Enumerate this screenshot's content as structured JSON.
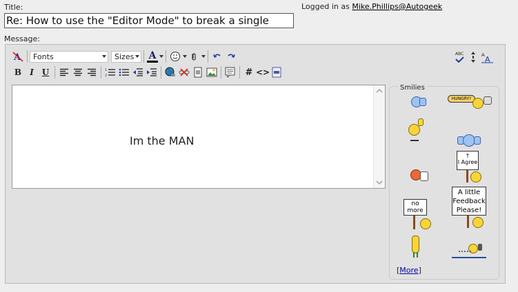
{
  "header": {
    "title_label": "Title:",
    "logged_in_prefix": "Logged in as ",
    "username": "Mike.Phillips@Autogeek"
  },
  "title_input": {
    "value": "Re: How to use the \"Editor Mode\" to break a single"
  },
  "message_label": "Message:",
  "toolbar": {
    "font_select": "Fonts",
    "size_select": "Sizes",
    "font_color_glyph": "A",
    "bold": "B",
    "italic": "I",
    "underline": "U",
    "hash": "#",
    "code": "<>",
    "spell_glyph": "ABC",
    "font_size_glyph": "AA",
    "icons": [
      "remove-format-icon",
      "smiley-icon",
      "attachment-icon",
      "undo-icon",
      "redo-icon",
      "align-left-icon",
      "align-center-icon",
      "align-right-icon",
      "ordered-list-icon",
      "unordered-list-icon",
      "outdent-icon",
      "indent-icon",
      "insert-link-icon",
      "unlink-icon",
      "insert-file-icon",
      "insert-image-icon",
      "quote-icon",
      "hash-icon",
      "code-icon",
      "php-icon",
      "spellcheck-icon",
      "resize-icon",
      "font-size-icon"
    ]
  },
  "editor": {
    "content": "Im the MAN"
  },
  "smilies": {
    "legend": "Smilies",
    "hungry_text": "HUNGRY?",
    "agree_text": "I Agree",
    "no_more_text": "no more",
    "feedback_text": "A little Feedback Please!",
    "more_bracket_open": "[",
    "more_label": "More",
    "more_bracket_close": "]",
    "colors": {
      "yellow": "#f7d53a",
      "blue": "#9ec3f2",
      "red": "#e86a3b"
    }
  }
}
